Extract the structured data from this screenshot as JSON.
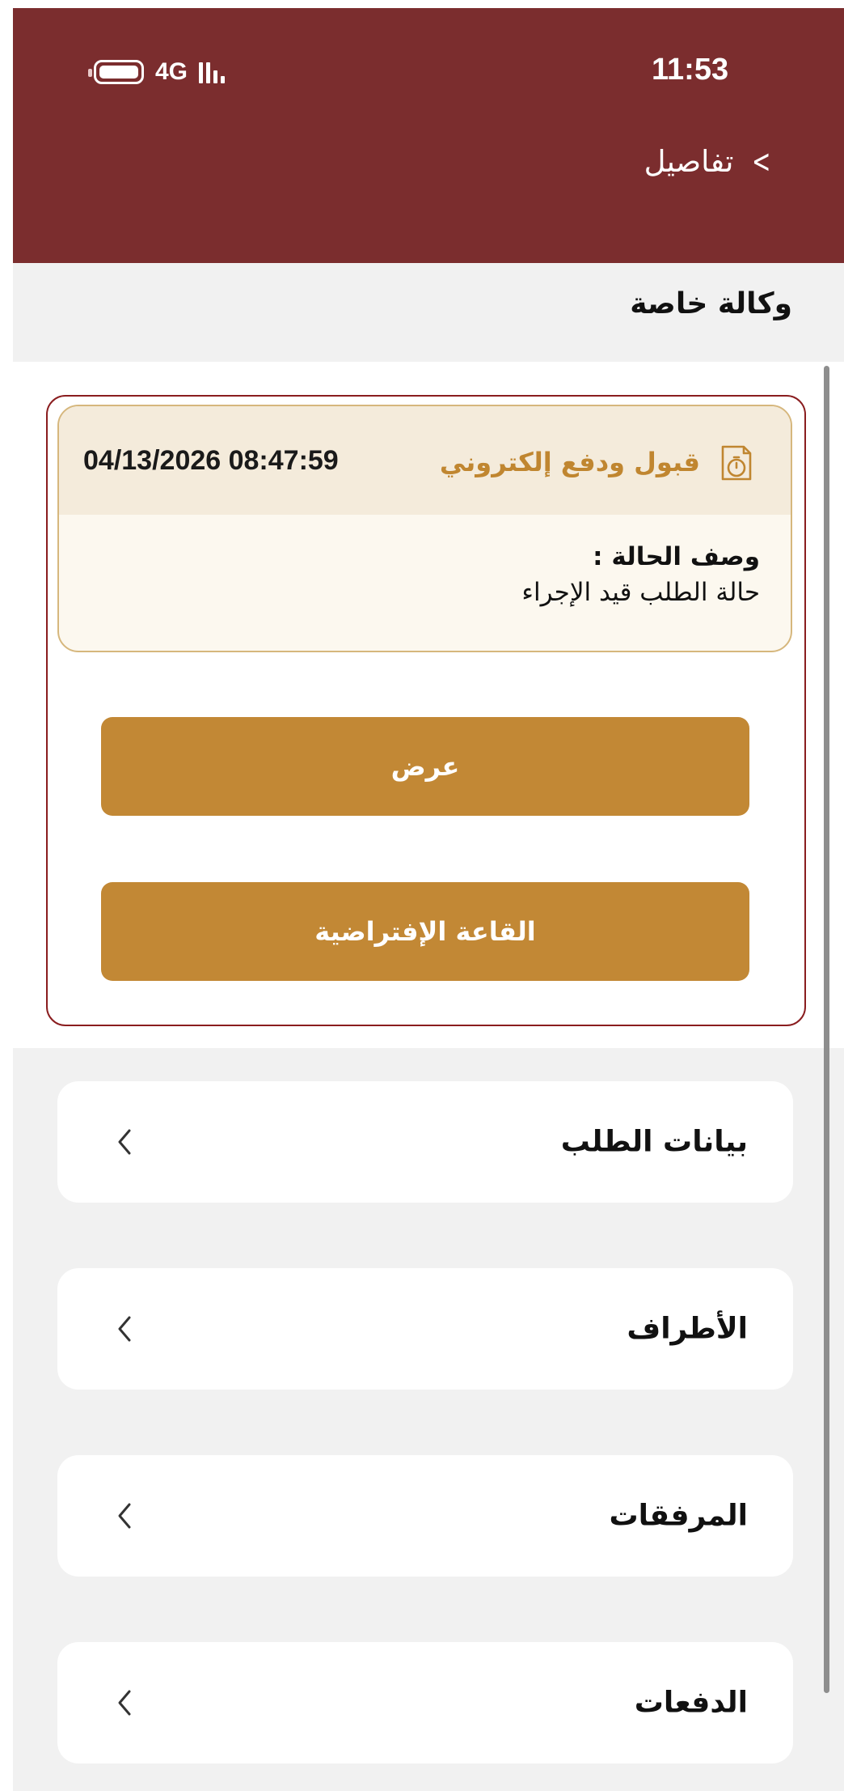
{
  "status_bar": {
    "time": "11:53",
    "network": "4G"
  },
  "header": {
    "title": "تفاصيل"
  },
  "request": {
    "type": "وكالة خاصة"
  },
  "status_card": {
    "status_label": "قبول ودفع إلكتروني",
    "datetime": "04/13/2026 08:47:59",
    "description_label": "وصف الحالة :",
    "description_value": "حالة الطلب قيد الإجراء",
    "icon": "stopwatch-document-icon"
  },
  "actions": {
    "view_label": "عرض",
    "virtual_hall_label": "القاعة الإفتراضية"
  },
  "sections": [
    {
      "label": "بيانات الطلب"
    },
    {
      "label": "الأطراف"
    },
    {
      "label": "المرفقات"
    },
    {
      "label": "الدفعات"
    }
  ],
  "colors": {
    "header_bg": "#7b2d2e",
    "accent_gold": "#c28835",
    "outline_red": "#8a1d1f",
    "card_border": "#d6b77d",
    "page_gray": "#f1f1f1"
  }
}
